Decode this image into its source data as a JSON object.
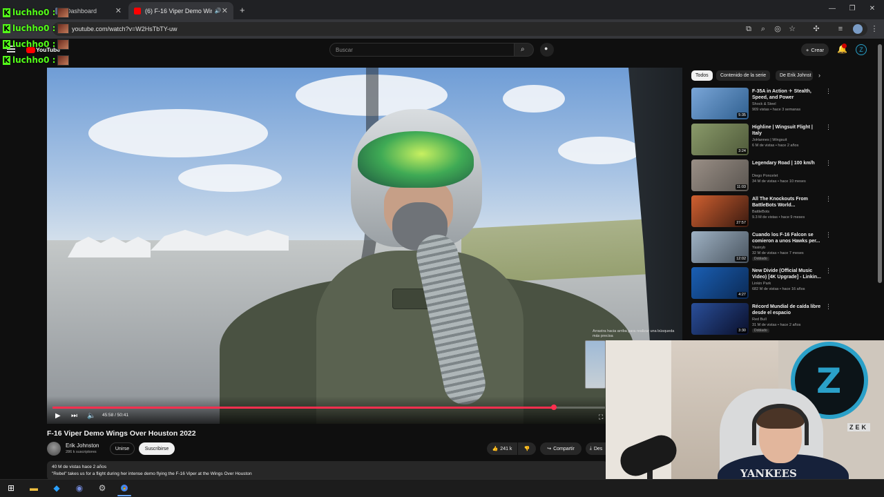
{
  "browser": {
    "tabs": [
      {
        "label": "Dashboard",
        "active": false
      },
      {
        "label": "(6) F-16 Viper Demo Wings",
        "active": true
      }
    ],
    "url": "youtube.com/watch?v=W2HsTbTY-uw"
  },
  "youtube": {
    "logo": "YouTube",
    "search_placeholder": "Buscar",
    "create_label": "Crear",
    "notification_count": "9+"
  },
  "player": {
    "time": "45:58 / 50:41",
    "progress": 0.907,
    "hint": "Arrastra hacia arriba para realizar una búsqueda más precisa"
  },
  "video": {
    "title": "F-16 Viper Demo Wings Over Houston 2022",
    "channel": "Erik Johnston",
    "subscribers": "286 k suscriptores",
    "join_label": "Unirse",
    "subscribe_label": "Suscribirse",
    "likes": "241 k",
    "share_label": "Compartir",
    "download_label": "Des",
    "views": "40 M de vistas  hace 2 años",
    "description": "\"Rebel\" takes us for a flight during her intense demo flying the F-16 Viper at the Wings Over Houston"
  },
  "sidebar": {
    "chips": [
      "Todos",
      "Contenido de la serie",
      "De Erik Johnst"
    ],
    "recs": [
      {
        "title": "F-35A in Action ✈ Stealth, Speed, and Power",
        "channel": "Shock & Steel",
        "meta": "909 vistas • hace 3 semanas",
        "duration": "5:35",
        "dub": ""
      },
      {
        "title": "Highline | Wingsuit Flight | Italy",
        "channel": "JoHannes | Wingsuit",
        "meta": "6 M de vistas • hace 2 años",
        "duration": "3:24",
        "dub": ""
      },
      {
        "title": "Legendary Road | 100 km/h",
        "channel": "Diego Poncelet",
        "meta": "34 M de vistas • hace 10 meses",
        "duration": "11:03",
        "dub": ""
      },
      {
        "title": "All The Knockouts From BattleBots World...",
        "channel": "BattleBots",
        "meta": "9.3 M de vistas • hace 9 meses",
        "duration": "27:57",
        "dub": ""
      },
      {
        "title": "Cuando los F-16 Falcon se comieron a unos Hawks per...",
        "channel": "Yasinyb",
        "meta": "32 M de vistas • hace 7 meses",
        "duration": "12:02",
        "dub": "Doblado"
      },
      {
        "title": "New Divide (Official Music Video) [4K Upgrade] - Linkin...",
        "channel": "Linkin Park",
        "meta": "682 M de vistas • hace 16 años",
        "duration": "4:27",
        "dub": ""
      },
      {
        "title": "Récord Mundial de caída libre desde el espacio",
        "channel": "Red Bull",
        "meta": "31 M de vistas • hace 2 años",
        "duration": "3:30",
        "dub": "Doblado"
      }
    ]
  },
  "chat": {
    "user": "luchho0 :",
    "rows": 4
  },
  "webcam": {
    "brand": "ZEK",
    "shirt_text": "YANKEES",
    "logo_letter": "Z"
  },
  "colors": {
    "accent": "#ff2f4f",
    "kick_green": "#53fc18",
    "bg": "#0f0f0f"
  }
}
